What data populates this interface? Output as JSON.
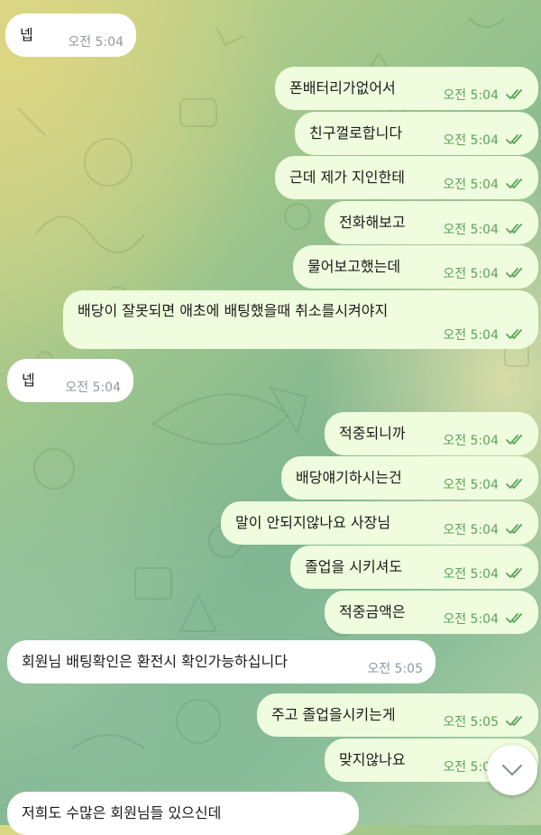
{
  "messages": [
    {
      "dir": "in",
      "text": "넵",
      "time": "오전 5:04"
    },
    {
      "dir": "out",
      "text": "폰배터리가없어서",
      "time": "오전 5:04"
    },
    {
      "dir": "out",
      "text": "친구껄로합니다",
      "time": "오전 5:04"
    },
    {
      "dir": "out",
      "text": "근데 제가 지인한테",
      "time": "오전 5:04"
    },
    {
      "dir": "out",
      "text": "전화해보고",
      "time": "오전 5:04"
    },
    {
      "dir": "out",
      "text": "물어보고했는데",
      "time": "오전 5:04"
    },
    {
      "dir": "out",
      "text": "배당이 잘못되면 애초에 배팅했을때 취소를시켜야지",
      "time": "오전 5:04"
    },
    {
      "dir": "in",
      "text": "넵",
      "time": "오전 5:04"
    },
    {
      "dir": "out",
      "text": "적중되니까",
      "time": "오전 5:04"
    },
    {
      "dir": "out",
      "text": "배당얘기하시는건",
      "time": "오전 5:04"
    },
    {
      "dir": "out",
      "text": "말이 안되지않나요 사장님",
      "time": "오전 5:04"
    },
    {
      "dir": "out",
      "text": "졸업을 시키셔도",
      "time": "오전 5:04"
    },
    {
      "dir": "out",
      "text": "적중금액은",
      "time": "오전 5:04"
    },
    {
      "dir": "in",
      "text": "회원님 배팅확인은 환전시 확인가능하십니다",
      "time": "오전 5:05"
    },
    {
      "dir": "out",
      "text": "주고 졸업을시키는게",
      "time": "오전 5:05"
    },
    {
      "dir": "out",
      "text": "맞지않나요",
      "time": "오전 5:05"
    },
    {
      "dir": "in",
      "text": "저희도 수많은 회원님들 있으신데",
      "time": ""
    }
  ],
  "icons": {
    "read_receipt": "double-check-icon",
    "scroll_down": "chevron-down-icon"
  },
  "colors": {
    "outgoing_bubble": "#effdde",
    "incoming_bubble": "#ffffff",
    "outgoing_time": "#5ba35a",
    "incoming_time": "#8e9aa3"
  }
}
